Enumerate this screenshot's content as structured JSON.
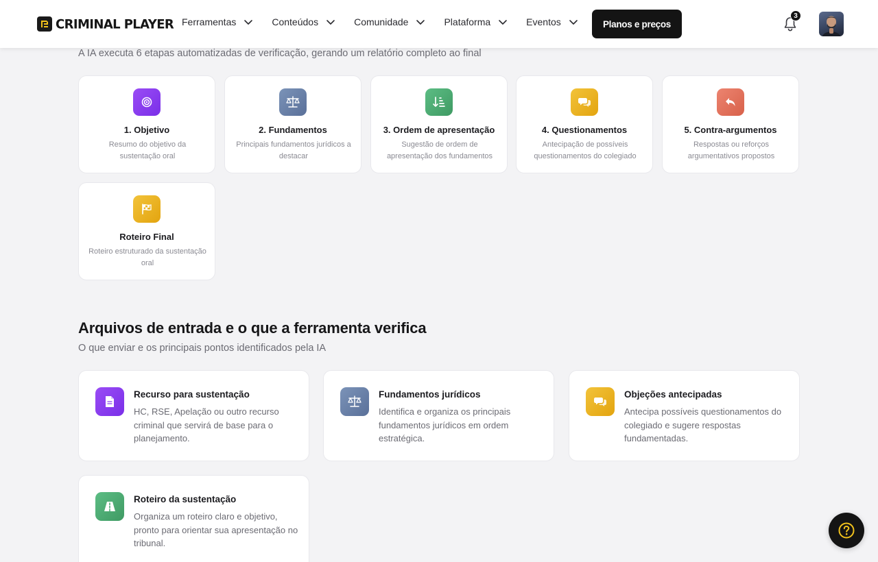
{
  "header": {
    "brand": "CRIMINAL PLAYER",
    "nav": [
      {
        "label": "Ferramentas"
      },
      {
        "label": "Conteúdos"
      },
      {
        "label": "Comunidade"
      },
      {
        "label": "Plataforma"
      },
      {
        "label": "Eventos"
      }
    ],
    "plans_button": "Planos e preços",
    "notifications_count": "3"
  },
  "steps_section": {
    "subtitle": "A IA executa 6 etapas automatizadas de verificação, gerando um relatório completo ao final",
    "steps": [
      {
        "title": "1. Objetivo",
        "description": "Resumo do objetivo da sustentação oral",
        "icon": "target-icon",
        "color": "#8b3df0"
      },
      {
        "title": "2. Fundamentos",
        "description": "Principais fundamentos jurídicos a destacar",
        "icon": "scale-icon",
        "color": "#6c83a8"
      },
      {
        "title": "3. Ordem de apresentação",
        "description": "Sugestão de ordem de apresentação dos fundamentos",
        "icon": "sort-list-icon",
        "color": "#4caa73"
      },
      {
        "title": "4. Questionamentos",
        "description": "Antecipação de possíveis questionamentos do colegiado",
        "icon": "chat-icon",
        "color": "#e8b422"
      },
      {
        "title": "5. Contra-argumentos",
        "description": "Respostas ou reforços argumentativos propostos",
        "icon": "reply-icon",
        "color": "#e0735d"
      },
      {
        "title": "Roteiro Final",
        "description": "Roteiro estruturado da sustentação oral",
        "icon": "flag-icon",
        "color": "#e8b422"
      }
    ]
  },
  "files_section": {
    "title": "Arquivos de entrada e o que a ferramenta verifica",
    "subtitle": "O que enviar e os principais pontos identificados pela IA",
    "cards": [
      {
        "title": "Recurso para sustentação",
        "description": "HC, RSE, Apelação ou outro recurso criminal que servirá de base para o planejamento.",
        "icon": "document-icon",
        "color": "#8b3df0"
      },
      {
        "title": "Fundamentos jurídicos",
        "description": "Identifica e organiza os principais fundamentos jurídicos em ordem estratégica.",
        "icon": "scale-icon",
        "color": "#6c83a8"
      },
      {
        "title": "Objeções antecipadas",
        "description": "Antecipa possíveis questionamentos do colegiado e sugere respostas fundamentadas.",
        "icon": "chat-icon",
        "color": "#e8b422"
      },
      {
        "title": "Roteiro da sustentação",
        "description": "Organiza um roteiro claro e objetivo, pronto para orientar sua apresentação no tribunal.",
        "icon": "road-icon",
        "color": "#4caa73"
      }
    ]
  }
}
